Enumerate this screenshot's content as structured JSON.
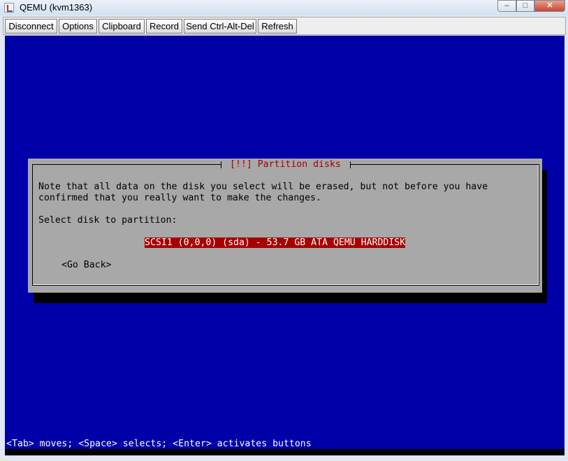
{
  "window": {
    "title": "QEMU (kvm1363)",
    "controls": {
      "minimize": "–",
      "maximize": "□",
      "close": "✕"
    }
  },
  "toolbar": {
    "buttons": [
      "Disconnect",
      "Options",
      "Clipboard",
      "Record",
      "Send Ctrl-Alt-Del",
      "Refresh"
    ]
  },
  "installer": {
    "dialog_title": "[!!] Partition disks",
    "note_line1": "Note that all data on the disk you select will be erased, but not before you have",
    "note_line2": "confirmed that you really want to make the changes.",
    "prompt": "Select disk to partition:",
    "disk_option": "SCSI1 (0,0,0) (sda) - 53.7 GB ATA QEMU HARDDISK",
    "go_back": "<Go Back>",
    "status_line": "<Tab> moves; <Space> selects; <Enter> activates buttons"
  },
  "colors": {
    "console_background": "#0000a8",
    "dialog_background": "#a8a8a8",
    "highlight": "#a80000"
  }
}
